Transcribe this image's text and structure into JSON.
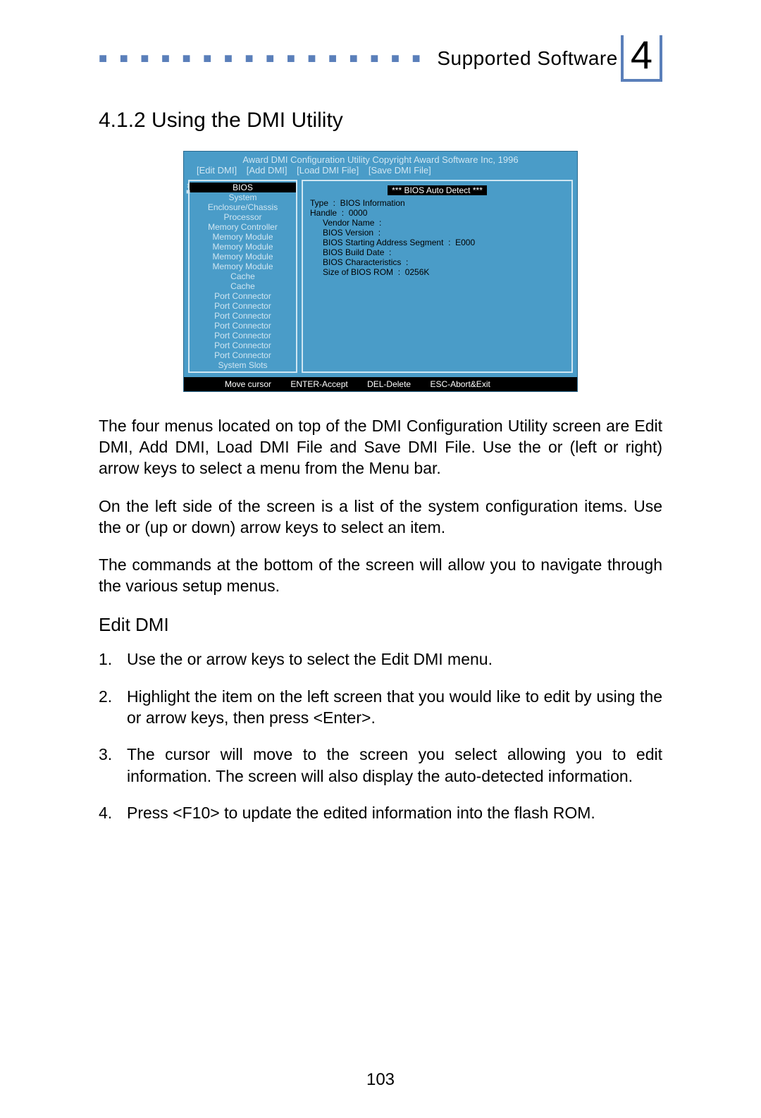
{
  "header": {
    "label": "Supported Software",
    "chapter_number": "4"
  },
  "section_title": "4.1.2  Using the DMI Utility",
  "dmi": {
    "title_line": "Award DMI Configuration Utility Copyright Award Software Inc, 1996",
    "menus": [
      "[Edit DMI]",
      "[Add DMI]",
      "[Load DMI File]",
      "[Save DMI File]"
    ],
    "left_items": [
      "BIOS",
      "System",
      "Enclosure/Chassis",
      "Processor",
      "Memory Controller",
      "Memory Module",
      "Memory Module",
      "Memory Module",
      "Memory Module",
      "Cache",
      "Cache",
      "Port Connector",
      "Port Connector",
      "Port Connector",
      "Port Connector",
      "Port Connector",
      "Port Connector",
      "Port Connector",
      "System Slots"
    ],
    "selected_index": 0,
    "right_header": "***   BIOS Auto Detect   ***",
    "right_lines": [
      "Type  :  BIOS Information",
      "Handle  :  0000",
      "Vendor Name  :",
      "BIOS Version  :",
      "BIOS Starting Address Segment  :  E000",
      "BIOS Build Date  :",
      "BIOS Characteristics  :",
      "Size of BIOS ROM  :  0256K"
    ],
    "bottom_cmds": [
      "Move cursor",
      "ENTER-Accept",
      "DEL-Delete",
      "ESC-Abort&Exit"
    ]
  },
  "body": {
    "p1": "The four menus located on top of the DMI Configuration Utility screen are Edit DMI, Add DMI, Load DMI File and Save DMI File. Use the    or    (left or right) arrow keys to select a menu from the Menu bar.",
    "p2": "On the left side of the screen is a list of the system configuration items. Use the   or   (up or down) arrow keys to select an item.",
    "p3": "The commands at the bottom of the screen will allow you to navigate through the various setup menus.",
    "subhead": "Edit DMI",
    "steps": [
      "Use the    or     arrow keys to select the Edit DMI menu.",
      "Highlight the item on the left screen that you would like to edit by using the  or    arrow keys, then press <Enter>.",
      "The cursor will move to the screen you select allowing you to edit information. The screen will also display the auto-detected information.",
      "Press <F10> to update the edited information into the flash ROM."
    ]
  },
  "page_number": "103"
}
